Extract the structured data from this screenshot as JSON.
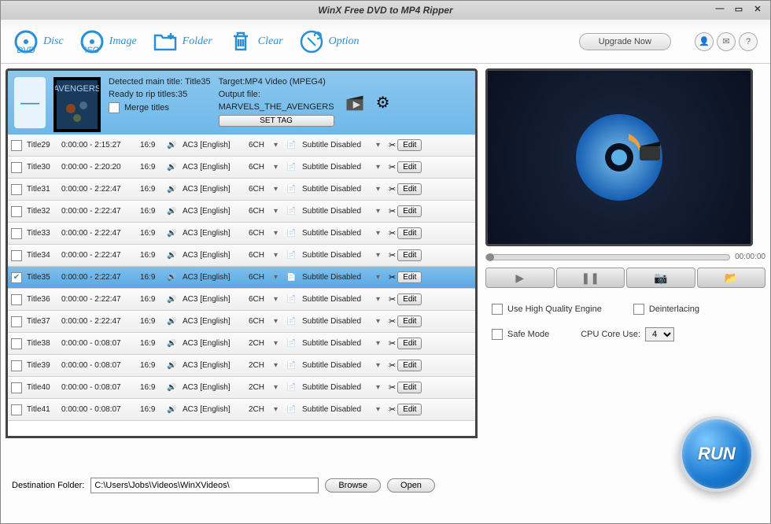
{
  "window": {
    "title": "WinX Free DVD to MP4 Ripper"
  },
  "toolbar": {
    "disc": "Disc",
    "image": "Image",
    "folder": "Folder",
    "clear": "Clear",
    "option": "Option",
    "upgrade": "Upgrade Now"
  },
  "main": {
    "detected_label": "Detected main title: Title35",
    "ready_label": "Ready to rip titles:35",
    "merge_label": "Merge titles",
    "target_label": "Target:MP4 Video (MPEG4)",
    "output_label": "Output file:",
    "output_file": "MARVELS_THE_AVENGERS",
    "settag": "SET TAG"
  },
  "titles": [
    {
      "name": "Title29",
      "time": "0:00:00 - 2:15:27",
      "ratio": "16:9",
      "audio": "AC3  [English]",
      "ch": "6CH",
      "sub": "Subtitle Disabled",
      "sel": false
    },
    {
      "name": "Title30",
      "time": "0:00:00 - 2:20:20",
      "ratio": "16:9",
      "audio": "AC3  [English]",
      "ch": "6CH",
      "sub": "Subtitle Disabled",
      "sel": false
    },
    {
      "name": "Title31",
      "time": "0:00:00 - 2:22:47",
      "ratio": "16:9",
      "audio": "AC3  [English]",
      "ch": "6CH",
      "sub": "Subtitle Disabled",
      "sel": false
    },
    {
      "name": "Title32",
      "time": "0:00:00 - 2:22:47",
      "ratio": "16:9",
      "audio": "AC3  [English]",
      "ch": "6CH",
      "sub": "Subtitle Disabled",
      "sel": false
    },
    {
      "name": "Title33",
      "time": "0:00:00 - 2:22:47",
      "ratio": "16:9",
      "audio": "AC3  [English]",
      "ch": "6CH",
      "sub": "Subtitle Disabled",
      "sel": false
    },
    {
      "name": "Title34",
      "time": "0:00:00 - 2:22:47",
      "ratio": "16:9",
      "audio": "AC3  [English]",
      "ch": "6CH",
      "sub": "Subtitle Disabled",
      "sel": false
    },
    {
      "name": "Title35",
      "time": "0:00:00 - 2:22:47",
      "ratio": "16:9",
      "audio": "AC3  [English]",
      "ch": "6CH",
      "sub": "Subtitle Disabled",
      "sel": true
    },
    {
      "name": "Title36",
      "time": "0:00:00 - 2:22:47",
      "ratio": "16:9",
      "audio": "AC3  [English]",
      "ch": "6CH",
      "sub": "Subtitle Disabled",
      "sel": false
    },
    {
      "name": "Title37",
      "time": "0:00:00 - 2:22:47",
      "ratio": "16:9",
      "audio": "AC3  [English]",
      "ch": "6CH",
      "sub": "Subtitle Disabled",
      "sel": false
    },
    {
      "name": "Title38",
      "time": "0:00:00 - 0:08:07",
      "ratio": "16:9",
      "audio": "AC3  [English]",
      "ch": "2CH",
      "sub": "Subtitle Disabled",
      "sel": false
    },
    {
      "name": "Title39",
      "time": "0:00:00 - 0:08:07",
      "ratio": "16:9",
      "audio": "AC3  [English]",
      "ch": "2CH",
      "sub": "Subtitle Disabled",
      "sel": false
    },
    {
      "name": "Title40",
      "time": "0:00:00 - 0:08:07",
      "ratio": "16:9",
      "audio": "AC3  [English]",
      "ch": "2CH",
      "sub": "Subtitle Disabled",
      "sel": false
    },
    {
      "name": "Title41",
      "time": "0:00:00 - 0:08:07",
      "ratio": "16:9",
      "audio": "AC3  [English]",
      "ch": "2CH",
      "sub": "Subtitle Disabled",
      "sel": false
    }
  ],
  "edit_label": "Edit",
  "preview": {
    "time": "00:00:00"
  },
  "options": {
    "hq": "Use High Quality Engine",
    "deint": "Deinterlacing",
    "safe": "Safe Mode",
    "cpu_label": "CPU Core Use:",
    "cpu_value": "4"
  },
  "run": "RUN",
  "dest": {
    "label": "Destination Folder:",
    "path": "C:\\Users\\Jobs\\Videos\\WinXVideos\\",
    "browse": "Browse",
    "open": "Open"
  }
}
